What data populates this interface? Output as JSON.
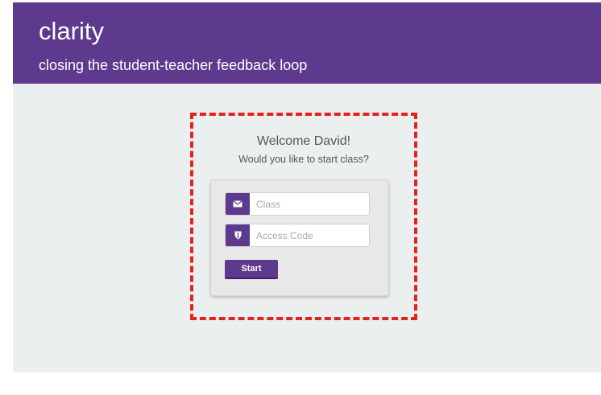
{
  "header": {
    "brand": "clarity",
    "tagline": "closing the student-teacher feedback loop",
    "background_color": "#5e3a8e"
  },
  "login": {
    "welcome": "Welcome David!",
    "question": "Would you like to start class?",
    "class_field": {
      "placeholder": "Class",
      "value": "",
      "icon": "envelope-icon"
    },
    "access_code_field": {
      "placeholder": "Access Code",
      "value": "",
      "icon": "shield-icon"
    },
    "start_label": "Start",
    "accent_color": "#5e3a8e",
    "highlight_color": "#e4231d"
  }
}
